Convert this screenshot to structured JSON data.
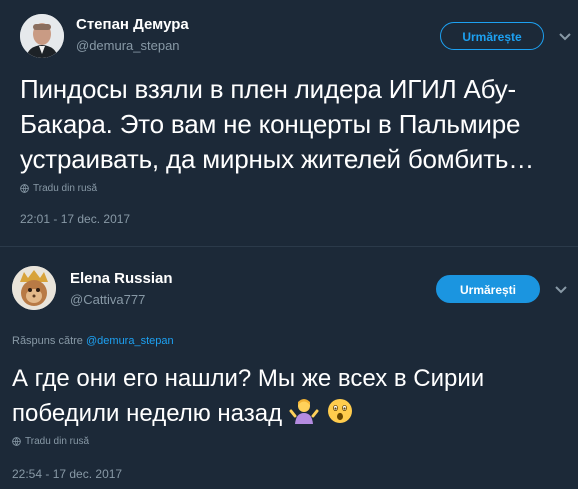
{
  "tweet1": {
    "author_name": "Степан Демура",
    "author_handle": "@demura_stepan",
    "follow_label": "Urmărește",
    "text_line1": "Пиндосы взяли в плен лидера ИГИЛ Абу-",
    "text_line2": "Бакара. Это вам не концерты в Пальмире",
    "text_line3": "устраивать, да мирных жителей бомбить…",
    "translate_label": "Tradu din rusă",
    "timestamp": "22:01 - 17 dec. 2017"
  },
  "tweet2": {
    "author_name": "Elena Russian",
    "author_handle": "@Cattiva777",
    "follow_label": "Urmărești",
    "reply_prefix": "Răspuns către",
    "reply_mention": "@demura_stepan",
    "text_line1": "А где они его нашли? Мы же всех в Сирии",
    "text_line2": "победили неделю назад",
    "translate_label": "Tradu din rusă",
    "timestamp": "22:54 - 17 dec. 2017"
  },
  "colors": {
    "background": "#1c2938",
    "accent": "#1da1f2",
    "muted": "#8899a6"
  },
  "icons": {
    "chevron": "chevron-down-icon",
    "globe": "globe-icon",
    "emoji_1": "person-shrugging-emoji",
    "emoji_2": "astonished-face-emoji"
  }
}
